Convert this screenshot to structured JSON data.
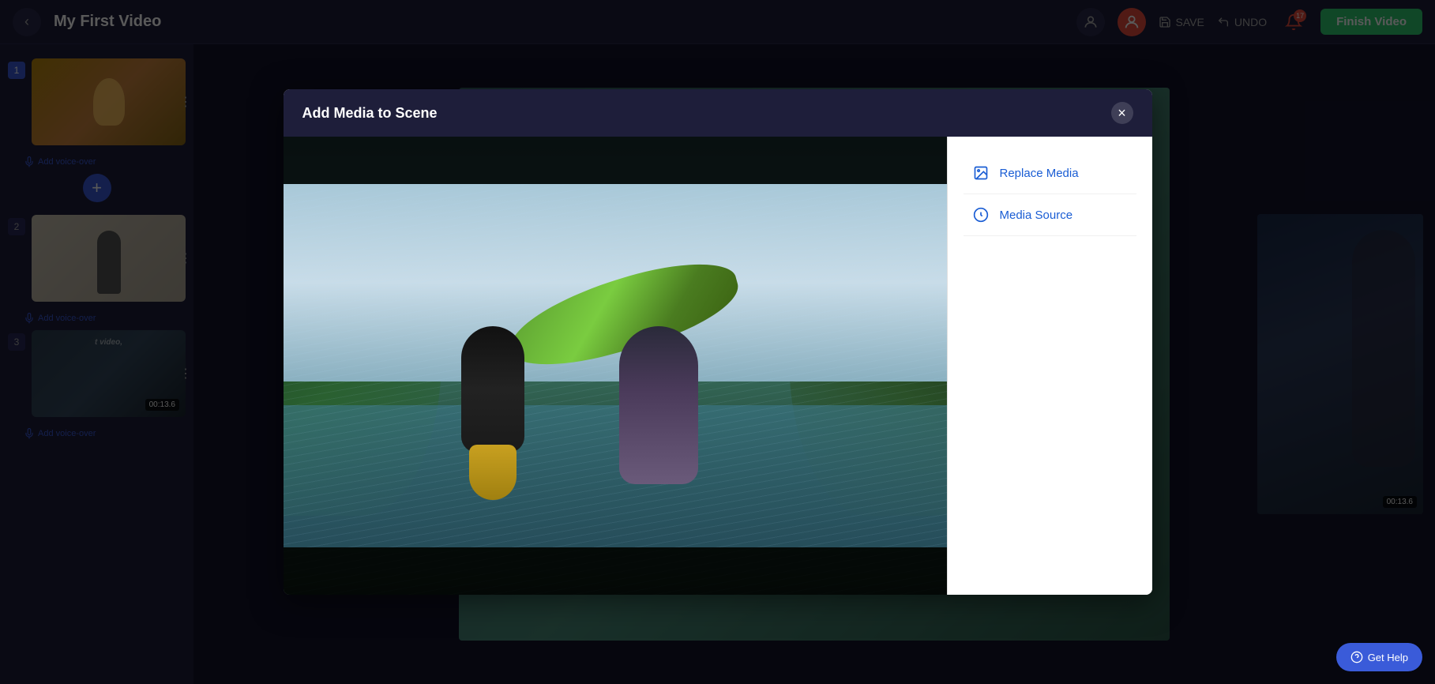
{
  "app": {
    "title": "My First Video",
    "back_label": "←"
  },
  "topbar": {
    "save_label": "SAVE",
    "undo_label": "UNDO",
    "finish_video_label": "Finish Video",
    "notification_count": "17"
  },
  "sidebar": {
    "scenes": [
      {
        "number": "1",
        "voice_label": "Add voice-over"
      },
      {
        "number": "2",
        "voice_label": "Add voice-over"
      },
      {
        "number": "3",
        "voice_label": "Add voice-over",
        "timestamp": "00:13.6"
      }
    ],
    "add_scene_label": "+"
  },
  "modal": {
    "title": "Add Media to Scene",
    "close_label": "×",
    "options": [
      {
        "label": "Replace Media",
        "icon": "image-icon"
      },
      {
        "label": "Media Source",
        "icon": "circle-icon"
      }
    ]
  },
  "help": {
    "label": "Get Help"
  }
}
